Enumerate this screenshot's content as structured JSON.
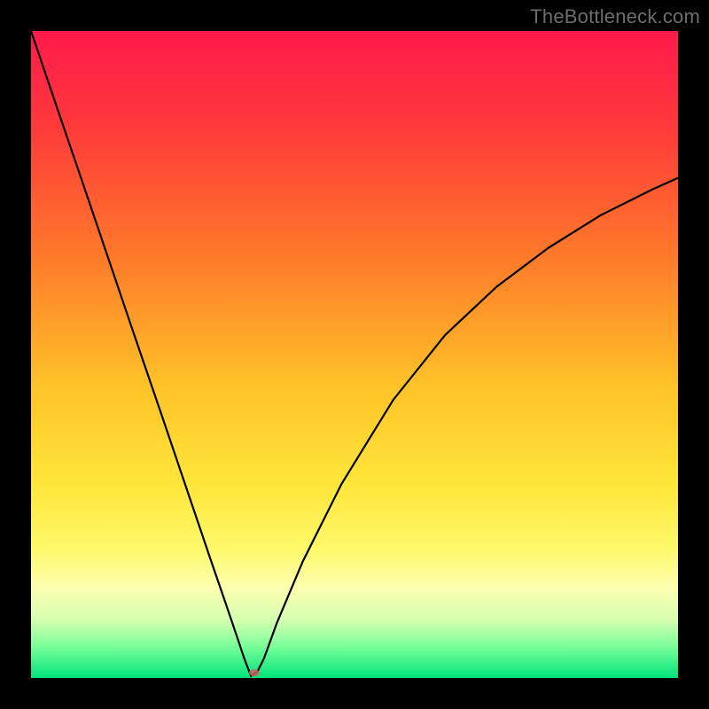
{
  "watermark": "TheBottleneck.com",
  "colors": {
    "frame": "#000000",
    "watermark": "#6d6d6d",
    "curve": "#000000",
    "marker": "#c86464",
    "gradient_stops": [
      {
        "pct": 0,
        "color": "#ff1a4b"
      },
      {
        "pct": 15,
        "color": "#ff3a3a"
      },
      {
        "pct": 35,
        "color": "#ff7a2a"
      },
      {
        "pct": 55,
        "color": "#ffc328"
      },
      {
        "pct": 70,
        "color": "#ffe63a"
      },
      {
        "pct": 80,
        "color": "#fff96a"
      },
      {
        "pct": 86,
        "color": "#fdffb0"
      },
      {
        "pct": 91,
        "color": "#d6ffb0"
      },
      {
        "pct": 95,
        "color": "#7dff9a"
      },
      {
        "pct": 100,
        "color": "#00e47a"
      }
    ]
  },
  "chart_data": {
    "type": "line",
    "title": "",
    "xlabel": "",
    "ylabel": "",
    "xlim": [
      0,
      100
    ],
    "ylim": [
      0,
      100
    ],
    "x": [
      0,
      4,
      8,
      12,
      16,
      20,
      24,
      28,
      30,
      32,
      33,
      34,
      35,
      36,
      38,
      42,
      48,
      56,
      64,
      72,
      80,
      88,
      96,
      100
    ],
    "values": [
      100,
      88.2,
      76.5,
      64.7,
      52.9,
      41.2,
      29.4,
      17.6,
      11.8,
      5.9,
      2.9,
      0.3,
      1.0,
      3.0,
      8.5,
      18.0,
      30.0,
      43.0,
      53.0,
      60.5,
      66.5,
      71.5,
      75.5,
      77.3
    ],
    "marker": {
      "x": 34.5,
      "y": 0.8
    },
    "note": "V-shaped bottleneck curve; minimum near x≈34 where y≈0. Left branch linear from (0,100), right branch sublinear rise toward ~77 at x=100. Values estimated from pixels."
  }
}
